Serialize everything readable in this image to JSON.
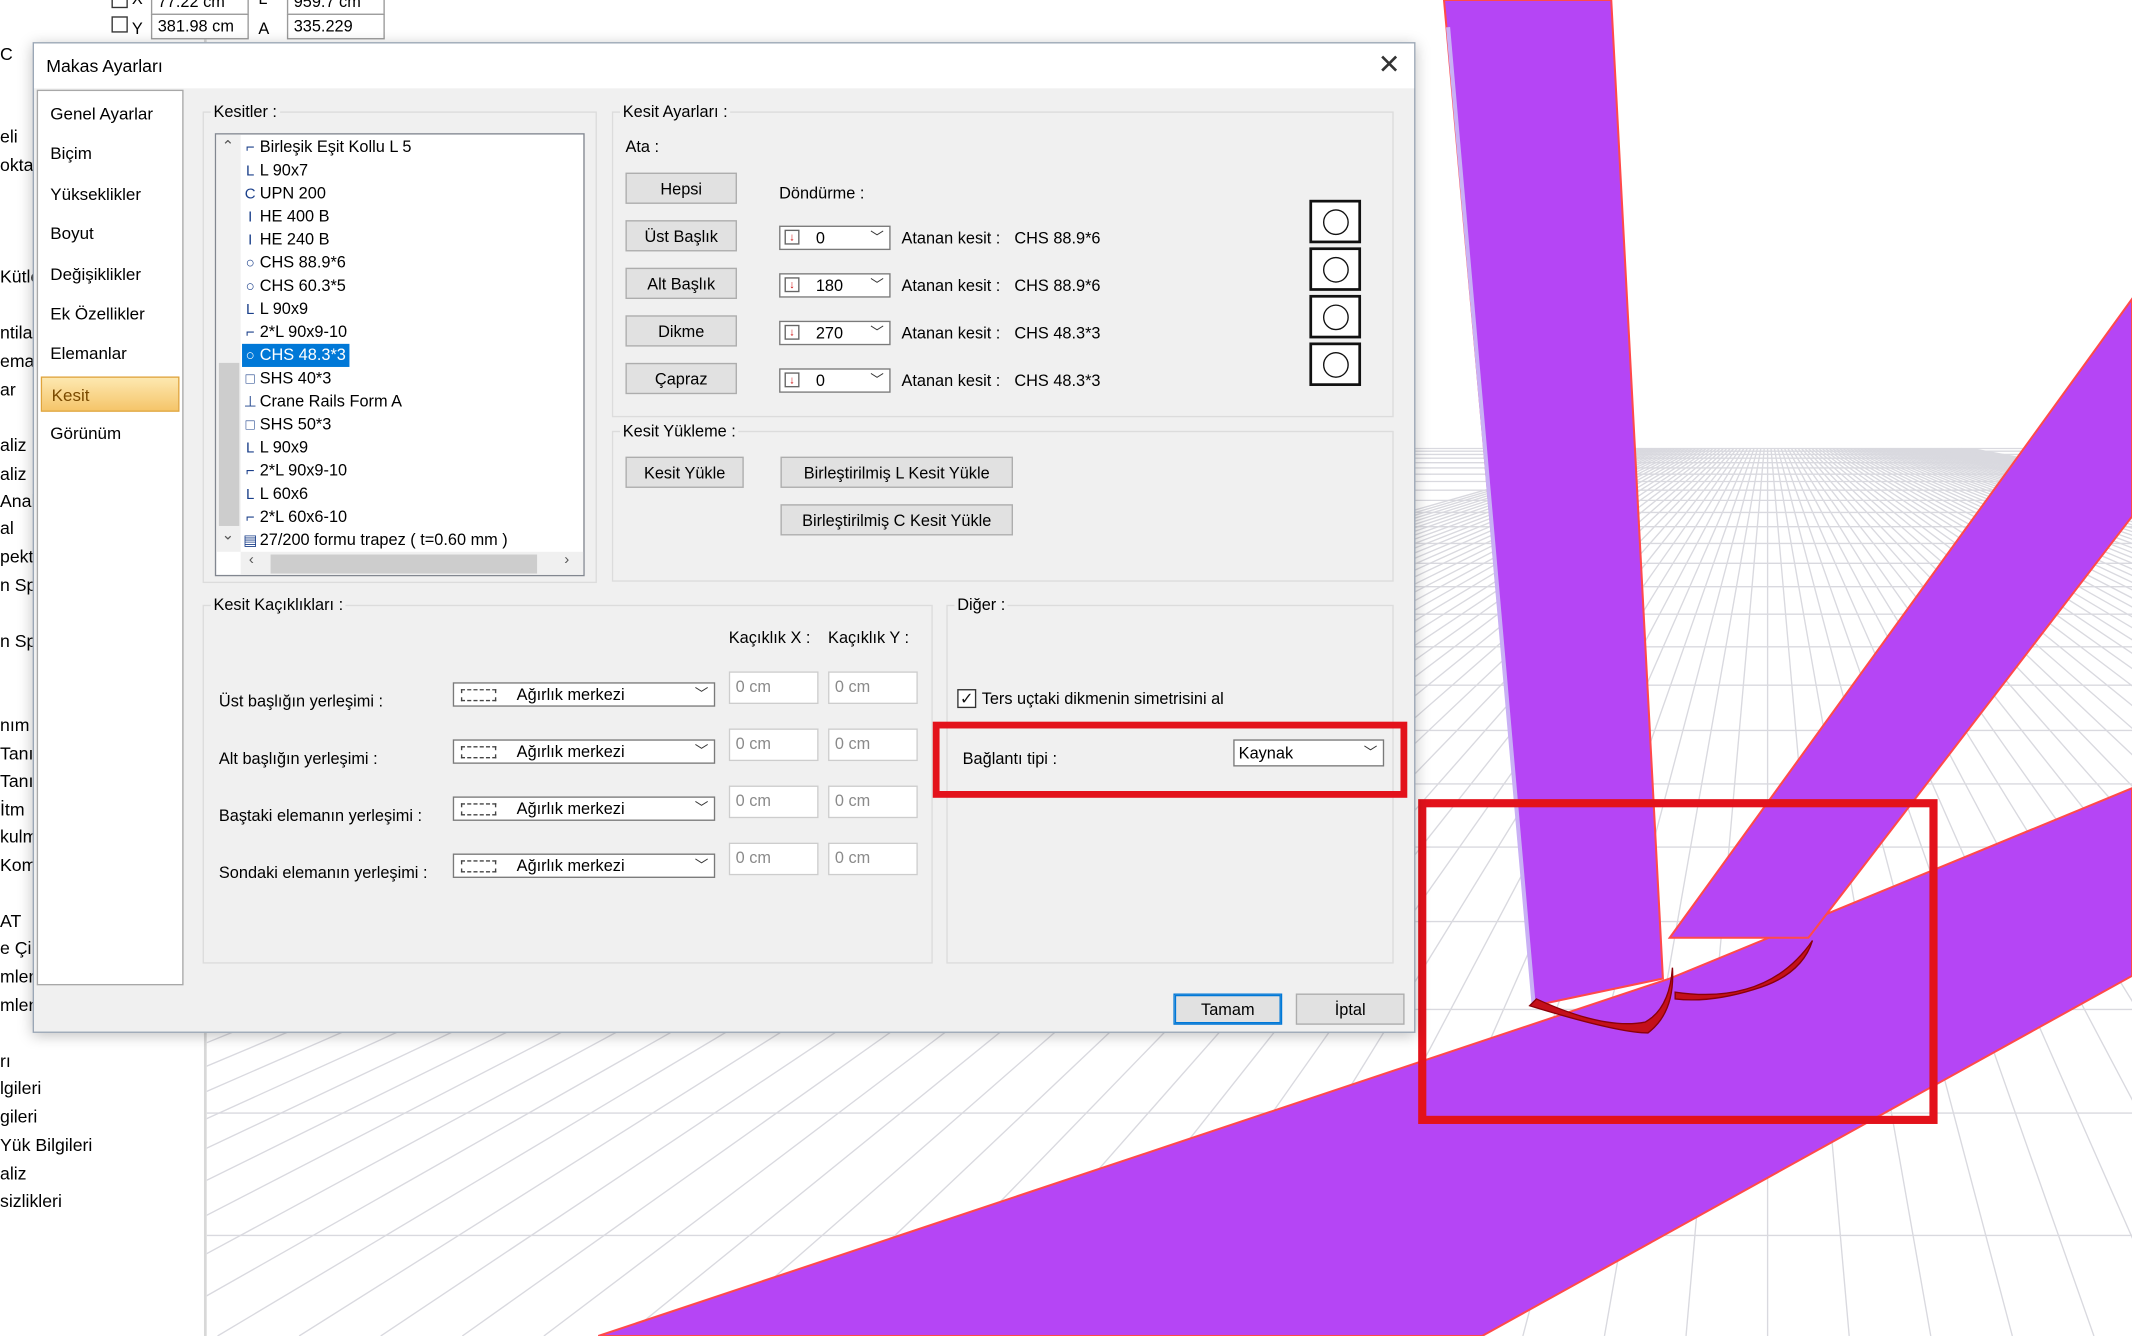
{
  "background": {
    "left_panel": [
      "C",
      "eli",
      "okta",
      "Kütle",
      "ntila",
      "ema",
      "ar",
      "aliz",
      "aliz",
      "Anal",
      "al",
      "pekt",
      "n Sp",
      "n Sp",
      "nım",
      "Tanı",
      "Tanı",
      "İtm",
      "kulm",
      "Kom",
      "AT",
      "e Çi",
      "mleri",
      "mlen",
      "rı",
      "lgileri",
      "gileri",
      "Yük Bilgileri",
      "aliz",
      "sizlikleri"
    ],
    "properties": {
      "x_label": "X",
      "x_value": "77.22 cm",
      "l_label": "L",
      "l_value": "959.7 cm",
      "y_label": "Y",
      "y_value": "381.98 cm",
      "a_label": "A",
      "a_value": "335.229"
    }
  },
  "dialog": {
    "title": "Makas Ayarları",
    "close_glyph": "✕",
    "nav": {
      "items": [
        "Genel Ayarlar",
        "Biçim",
        "Yükseklikler",
        "Boyut",
        "Değişiklikler",
        "Ek Özellikler",
        "Elemanlar",
        "Kesit",
        "Görünüm"
      ],
      "active": "Kesit"
    },
    "kesitler": {
      "label": "Kesitler :",
      "items": [
        {
          "icon": "⌐",
          "text": "Birleşik Eşit Kollu L 5"
        },
        {
          "icon": "L",
          "text": "L 90x7"
        },
        {
          "icon": "C",
          "text": "UPN 200"
        },
        {
          "icon": "I",
          "text": "HE 400 B"
        },
        {
          "icon": "I",
          "text": "HE 240 B"
        },
        {
          "icon": "○",
          "text": "CHS 88.9*6"
        },
        {
          "icon": "○",
          "text": "CHS 60.3*5"
        },
        {
          "icon": "L",
          "text": "L 90x9"
        },
        {
          "icon": "⌐",
          "text": "2*L 90x9-10"
        },
        {
          "icon": "○",
          "text": "CHS 48.3*3"
        },
        {
          "icon": "□",
          "text": "SHS 40*3"
        },
        {
          "icon": "⊥",
          "text": "Crane Rails Form A"
        },
        {
          "icon": "□",
          "text": "SHS 50*3"
        },
        {
          "icon": "L",
          "text": "L 90x9"
        },
        {
          "icon": "⌐",
          "text": "2*L 90x9-10"
        },
        {
          "icon": "L",
          "text": "L 60x6"
        },
        {
          "icon": "⌐",
          "text": "2*L 60x6-10"
        },
        {
          "icon": "▤",
          "text": "27/200 formu trapez ( t=0.60 mm )"
        }
      ],
      "selected_index": 9
    },
    "kesit_ayarlari": {
      "label": "Kesit Ayarları :",
      "ata_label": "Ata :",
      "dondurme_label": "Döndürme :",
      "hepsi": "Hepsi",
      "rows": [
        {
          "button": "Üst Başlık",
          "rotation": "0",
          "assigned_label": "Atanan kesit :",
          "assigned": "CHS 88.9*6"
        },
        {
          "button": "Alt Başlık",
          "rotation": "180",
          "assigned_label": "Atanan kesit :",
          "assigned": "CHS 88.9*6"
        },
        {
          "button": "Dikme",
          "rotation": "270",
          "assigned_label": "Atanan kesit :",
          "assigned": "CHS 48.3*3"
        },
        {
          "button": "Çapraz",
          "rotation": "0",
          "assigned_label": "Atanan kesit :",
          "assigned": "CHS 48.3*3"
        }
      ]
    },
    "kesit_yukleme": {
      "label": "Kesit Yükleme :",
      "load": "Kesit Yükle",
      "load_l": "Birleştirilmiş L Kesit Yükle",
      "load_c": "Birleştirilmiş C Kesit Yükle"
    },
    "kesit_kaciklik": {
      "label": "Kesit Kaçıklıkları :",
      "col_x": "Kaçıklık X :",
      "col_y": "Kaçıklık Y :",
      "rows": [
        {
          "label": "Üst başlığın yerleşimi :",
          "value": "Ağırlık merkezi",
          "x": "0 cm",
          "y": "0 cm"
        },
        {
          "label": "Alt başlığın yerleşimi :",
          "value": "Ağırlık merkezi",
          "x": "0 cm",
          "y": "0 cm"
        },
        {
          "label": "Baştaki elemanın yerleşimi :",
          "value": "Ağırlık merkezi",
          "x": "0 cm",
          "y": "0 cm"
        },
        {
          "label": "Sondaki elemanın yerleşimi :",
          "value": "Ağırlık merkezi",
          "x": "0 cm",
          "y": "0 cm"
        }
      ]
    },
    "diger": {
      "label": "Diğer :",
      "mirror_checkbox": "Ters uçtaki dikmenin simetrisini al",
      "mirror_checked": true,
      "connection_label": "Bağlantı tipi :",
      "connection_value": "Kaynak"
    },
    "ok": "Tamam",
    "cancel": "İptal"
  },
  "colors": {
    "member_fill": "#b545f5",
    "member_edge": "#ff4a4a",
    "weld": "#c4101a",
    "highlight": "#e3121b",
    "grid": "#d9d9df"
  }
}
